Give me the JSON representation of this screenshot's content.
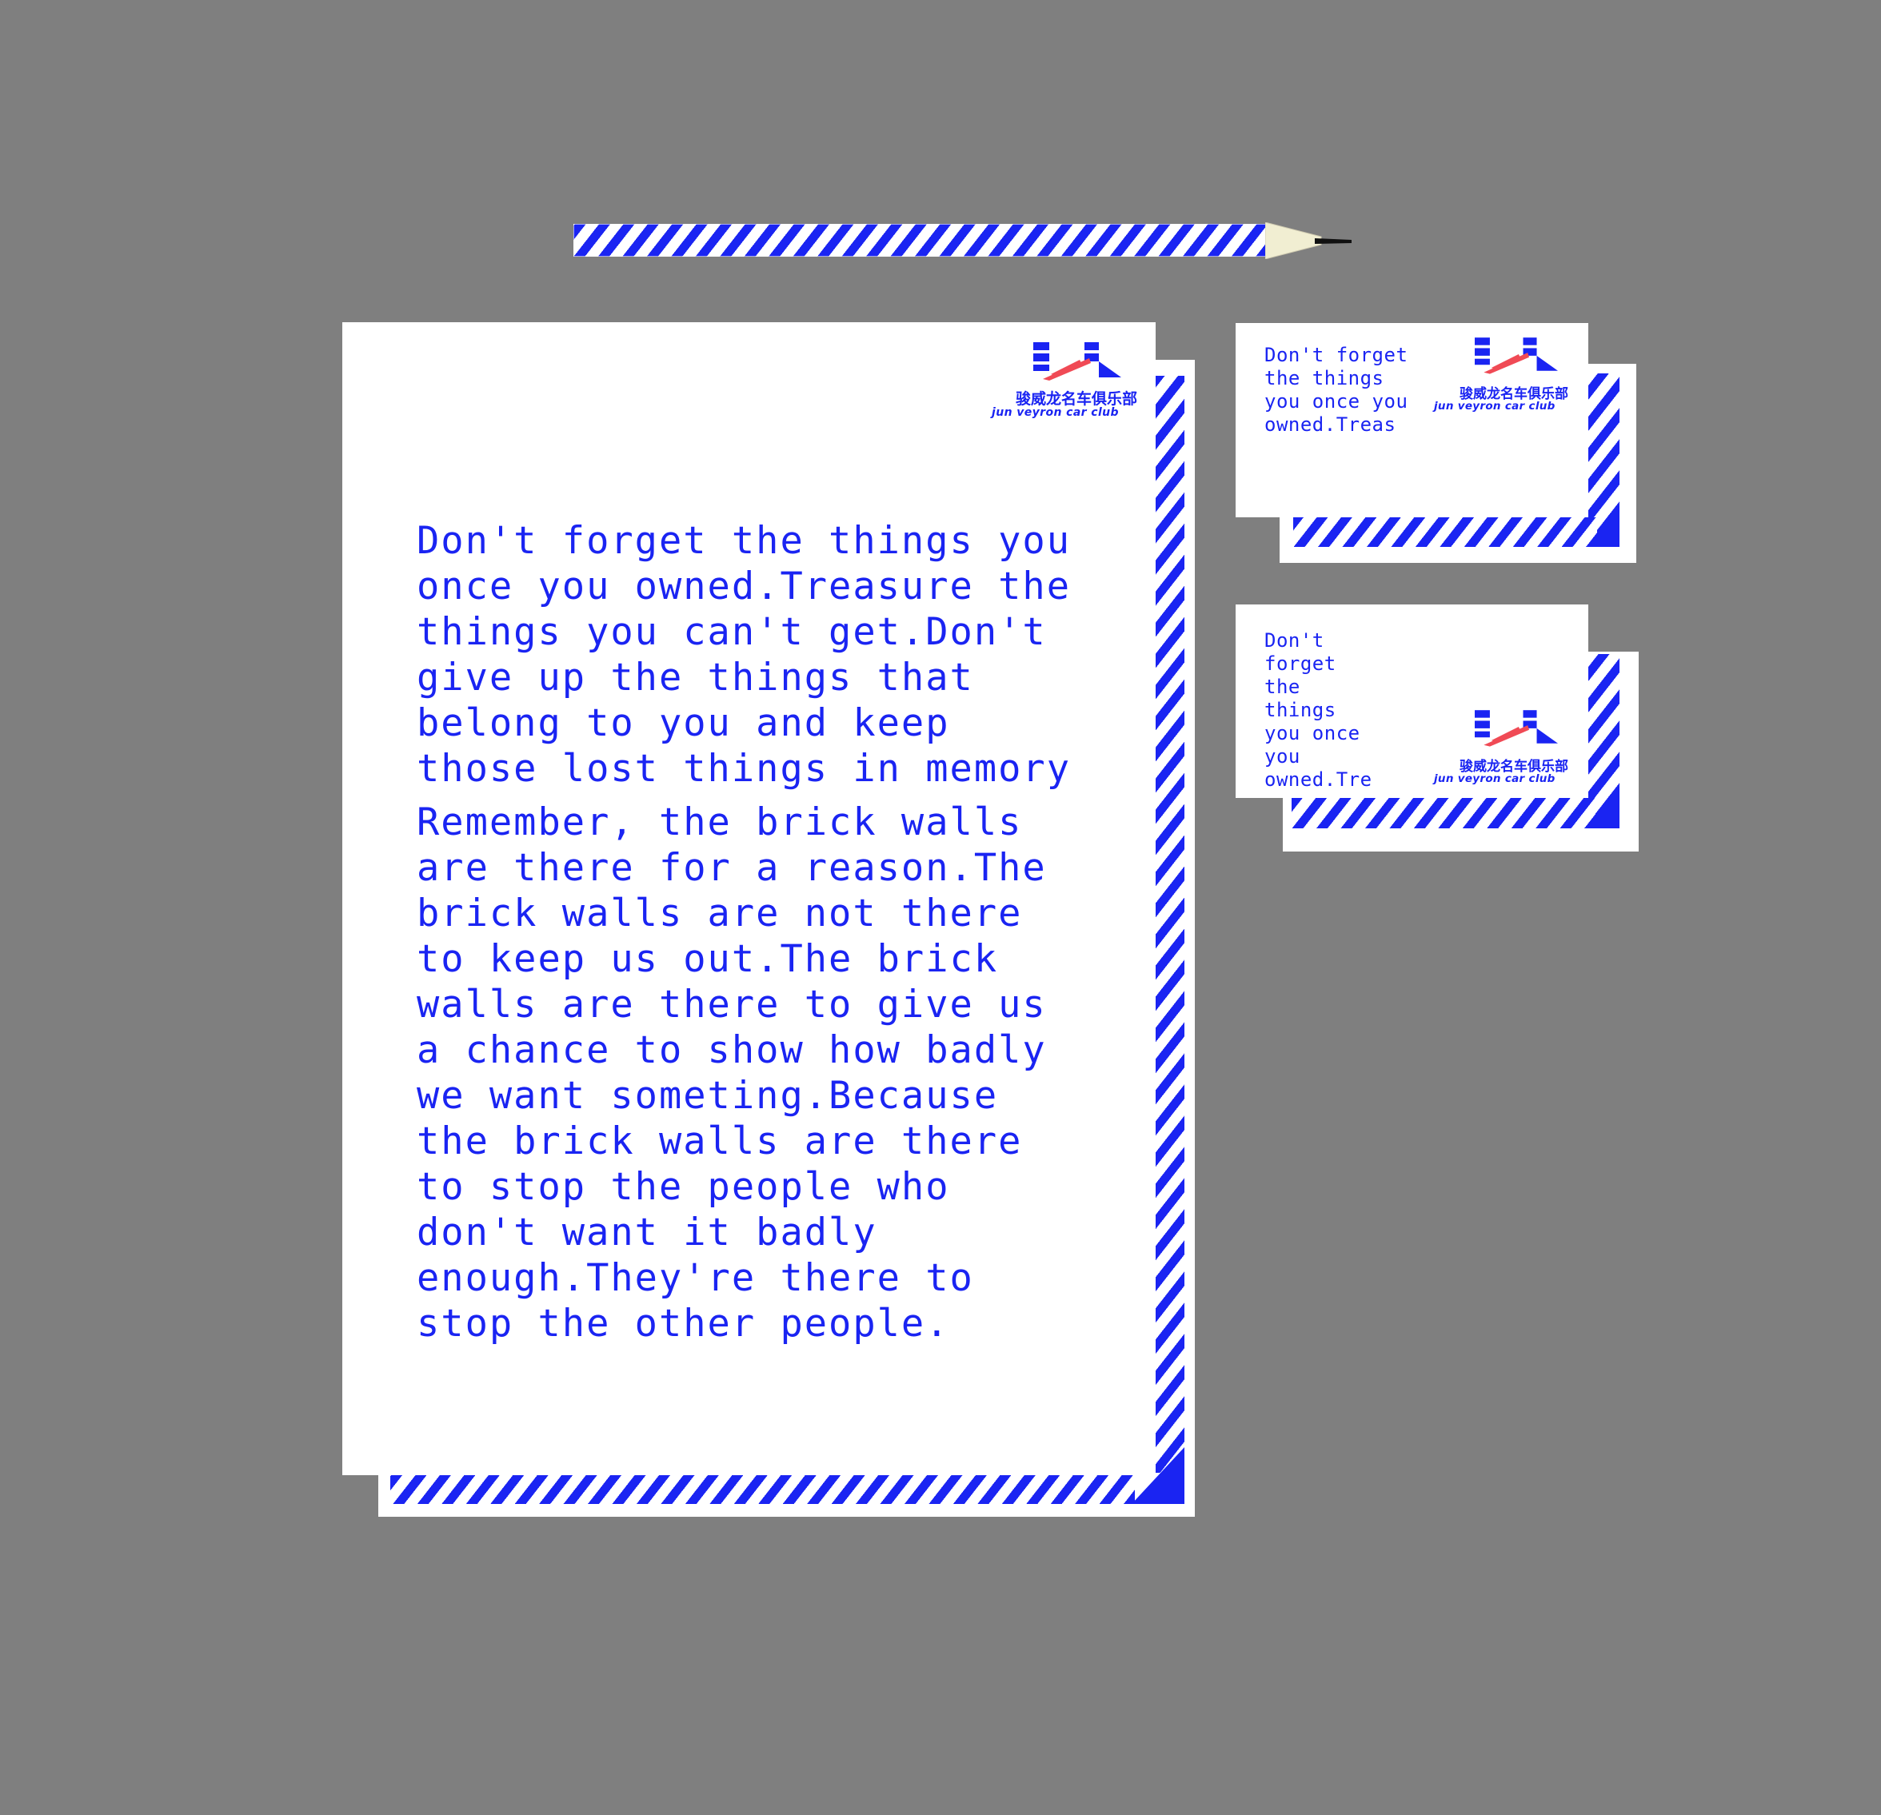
{
  "letterhead": {
    "logo": {
      "name_cn": "骏威龙名车俱乐部",
      "name_en": "jun veyron car club"
    },
    "paragraphs": [
      "Don't forget the things you once you owned.Treasure the things you can't get.Don't give up the things that belong to you and keep those lost things in memory",
      "Remember, the brick walls are there for a reason.The brick walls are not there to keep us out.The brick walls are there to give us a chance to show how badly we want someting.Because the brick walls are there to stop the people who don't want it badly enough.They're there to stop the other people."
    ]
  },
  "business_cards": [
    {
      "text": "Don't forget\nthe things\nyou once you\nowned.Treas",
      "logo": {
        "name_cn": "骏威龙名车俱乐部",
        "name_en": "jun veyron car club"
      }
    },
    {
      "text": "Don't\nforget\nthe\nthings\nyou once\nyou\nowned.Tre",
      "logo": {
        "name_cn": "骏威龙名车俱乐部",
        "name_en": "jun veyron car club"
      }
    }
  ],
  "colors": {
    "background": "#7f7f7f",
    "brand_blue": "#1a24f2",
    "brand_red": "#f04a55",
    "paper": "#ffffff"
  },
  "icons": [
    "pencil-icon",
    "car-club-logo-icon"
  ]
}
